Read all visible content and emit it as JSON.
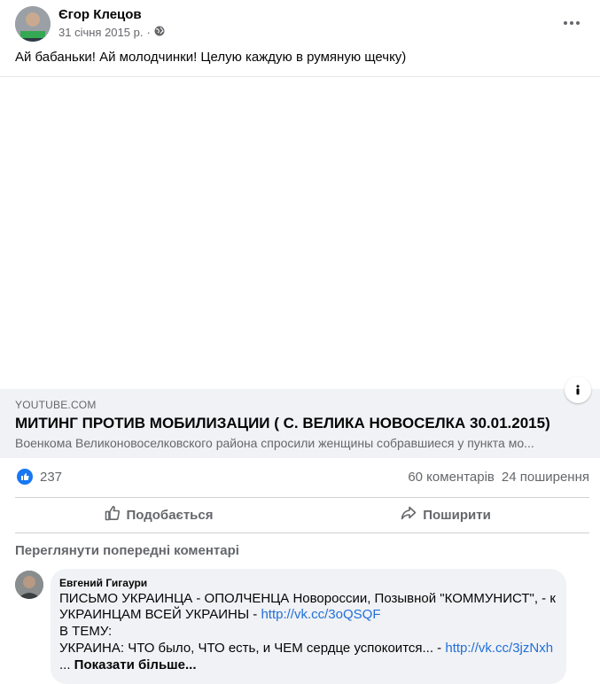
{
  "post": {
    "author": "Єгор Клецов",
    "date": "31 січня 2015 р.",
    "date_separator": "·",
    "text": "Ай бабаньки! Ай молодчинки! Целую каждую в румяную щечку)"
  },
  "link_card": {
    "source": "YOUTUBE.COM",
    "title": "МИТИНГ ПРОТИВ МОБИЛИЗАЦИИ ( С. ВЕЛИКА НОВОСЕЛКА 30.01.2015)",
    "description": "Военкома Великоновоселковского района спросили женщины собравшиеся у пункта мо..."
  },
  "stats": {
    "likes": "237",
    "comments": "60 коментарів",
    "shares": "24 поширення"
  },
  "actions": {
    "like": "Подобається",
    "share": "Поширити"
  },
  "comments": {
    "view_previous": "Переглянути попередні коментарі",
    "items": [
      {
        "author": "Евгений Гигаури",
        "line1": "ПИСЬМО УКРАИНЦА - ОПОЛЧЕНЦА Новороссии, Позывной \"КОММУНИСТ\", - к",
        "line2_text": "УКРАИНЦАМ ВСЕЙ УКРАИНЫ - ",
        "line2_link": "http://vk.cc/3oQSQF",
        "line3": "В ТЕМУ:",
        "line4_text": "УКРАИНА: ЧТО было, ЧТО есть, и ЧЕМ сердце успокоится... - ",
        "line4_link": "http://vk.cc/3jzNxh",
        "line5_prefix": "... ",
        "see_more": "Показати більше..."
      }
    ]
  },
  "colors": {
    "accent": "#1877f2",
    "link": "#216fdb",
    "secondary_text": "#65676b",
    "card_bg": "#f0f2f5"
  },
  "icons": {
    "globe": "globe-icon",
    "more": "more-dots-icon",
    "info": "info-icon",
    "like": "like-thumb-icon",
    "share": "share-arrow-icon"
  }
}
